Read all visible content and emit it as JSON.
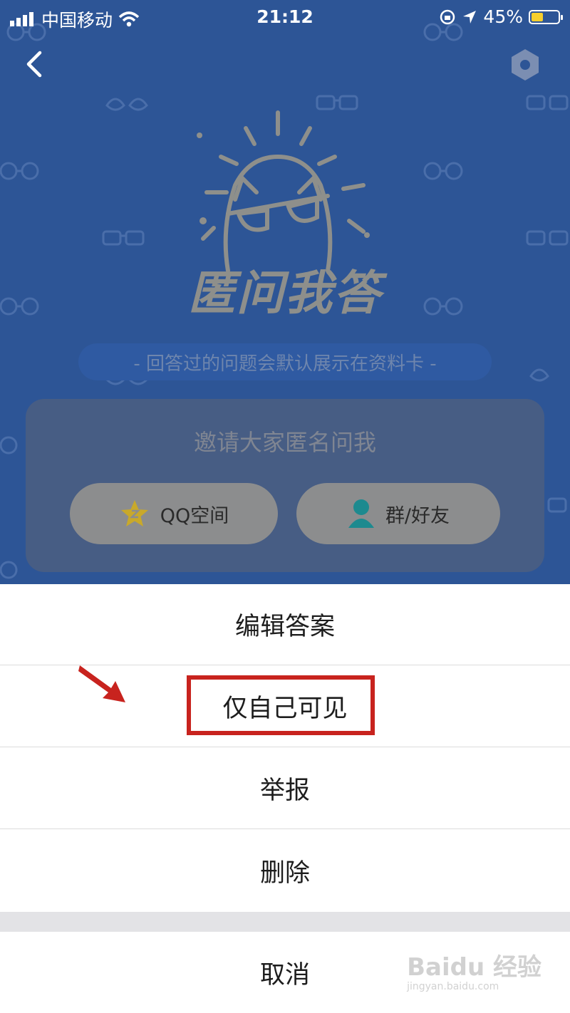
{
  "status_bar": {
    "carrier": "中国移动",
    "time": "21:12",
    "battery": "45%",
    "battery_level": 0.45
  },
  "header": {
    "back_icon": "chevron-left-icon",
    "settings_icon": "gear-icon"
  },
  "hero": {
    "logo_text": "匿问我答",
    "tip": "- 回答过的问题会默认展示在资料卡 -"
  },
  "invite": {
    "title": "邀请大家匿名问我",
    "qq_zone_label": "QQ空间",
    "group_friends_label": "群/好友"
  },
  "action_sheet": {
    "items": [
      {
        "label": "编辑答案"
      },
      {
        "label": "仅自己可见"
      },
      {
        "label": "举报"
      },
      {
        "label": "删除"
      }
    ],
    "cancel_label": "取消"
  },
  "colors": {
    "background": "#2d5596",
    "highlight": "#c8231e"
  },
  "watermark": {
    "brand": "Baidu 经验",
    "url": "jingyan.baidu.com"
  }
}
